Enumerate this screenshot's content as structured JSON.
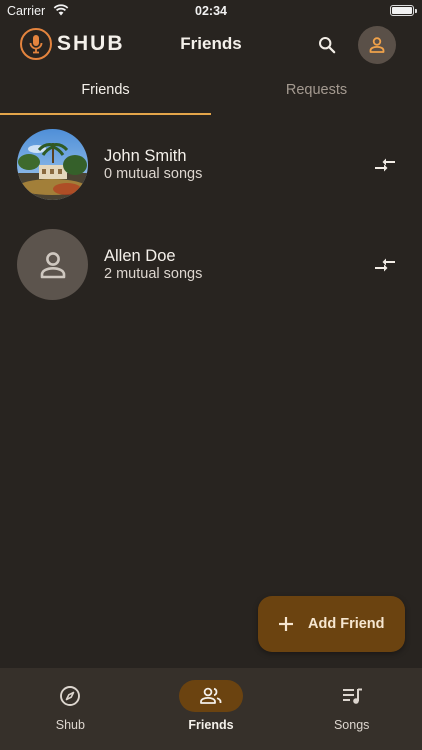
{
  "status_bar": {
    "carrier": "Carrier",
    "time": "02:34"
  },
  "header": {
    "logo_text": "SHUB",
    "title": "Friends",
    "search_icon": "search-icon",
    "profile_icon": "person-icon"
  },
  "tabs": [
    {
      "label": "Friends",
      "active": true
    },
    {
      "label": "Requests",
      "active": false
    }
  ],
  "friends": [
    {
      "name": "John Smith",
      "subtitle": "0 mutual songs",
      "avatar": "photo",
      "action_icon": "compare-arrows-icon"
    },
    {
      "name": "Allen Doe",
      "subtitle": "2 mutual songs",
      "avatar": "default-person",
      "action_icon": "compare-arrows-icon"
    }
  ],
  "fab": {
    "label": "Add Friend",
    "icon": "plus-icon"
  },
  "bottom_nav": [
    {
      "label": "Shub",
      "icon": "compass-icon",
      "active": false
    },
    {
      "label": "Friends",
      "icon": "people-icon",
      "active": true
    },
    {
      "label": "Songs",
      "icon": "queue-music-icon",
      "active": false
    }
  ],
  "colors": {
    "background": "#282420",
    "accent": "#e4843e",
    "tab_indicator": "#e4a54a",
    "fab_background": "#6b4310",
    "nav_background": "#36302a"
  }
}
